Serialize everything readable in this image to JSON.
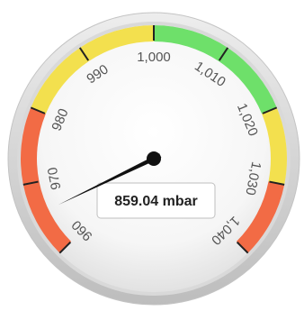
{
  "chart_data": {
    "type": "gauge",
    "title": "",
    "value": 859.04,
    "unit": "mbar",
    "readout": "859.04 mbar",
    "min": 960,
    "max": 1040,
    "tick_step": 10,
    "ticks": [
      {
        "value": 960,
        "label": "960"
      },
      {
        "value": 970,
        "label": "970"
      },
      {
        "value": 980,
        "label": "980"
      },
      {
        "value": 990,
        "label": "990"
      },
      {
        "value": 1000,
        "label": "1,000"
      },
      {
        "value": 1010,
        "label": "1,010"
      },
      {
        "value": 1020,
        "label": "1,020"
      },
      {
        "value": 1030,
        "label": "1,030"
      },
      {
        "value": 1040,
        "label": "1,040"
      }
    ],
    "bands": [
      {
        "from": 960,
        "to": 980,
        "color": "#f26b45"
      },
      {
        "from": 980,
        "to": 1000,
        "color": "#f3e04e"
      },
      {
        "from": 1000,
        "to": 1020,
        "color": "#6ee06a"
      },
      {
        "from": 1020,
        "to": 1030,
        "color": "#f3e04e"
      },
      {
        "from": 1030,
        "to": 1040,
        "color": "#f26b45"
      }
    ]
  }
}
